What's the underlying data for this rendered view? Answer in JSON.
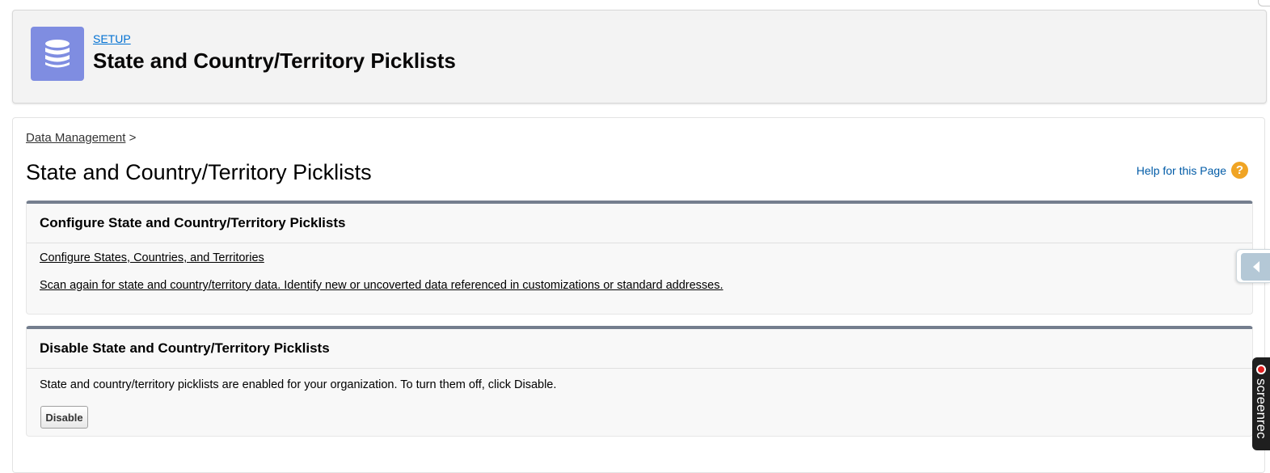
{
  "header": {
    "setup_label": "SETUP",
    "title": "State and Country/Territory Picklists",
    "icon": "database-icon",
    "icon_color": "#7f8de1"
  },
  "breadcrumb": {
    "link": "Data Management",
    "separator": ">"
  },
  "page_title": "State and Country/Territory Picklists",
  "help": {
    "label": "Help for this Page",
    "icon": "help-icon",
    "icon_glyph": "?",
    "icon_color": "#f0a424"
  },
  "configure_section": {
    "title": "Configure State and Country/Territory Picklists",
    "links": [
      "Configure States, Countries, and Territories",
      "Scan again for state and country/territory data. Identify new or uncoverted data referenced in customizations or standard addresses."
    ]
  },
  "disable_section": {
    "title": "Disable State and Country/Territory Picklists",
    "text": "State and country/territory picklists are enabled for your organization. To turn them off, click Disable.",
    "button_label": "Disable"
  },
  "overlay": {
    "side_tab_icon": "chevron-left-icon",
    "recorder_label": "screenrec"
  },
  "colors": {
    "section_border": "#747e8e",
    "link_blue": "#0070d2",
    "help_link": "#015ba7"
  }
}
